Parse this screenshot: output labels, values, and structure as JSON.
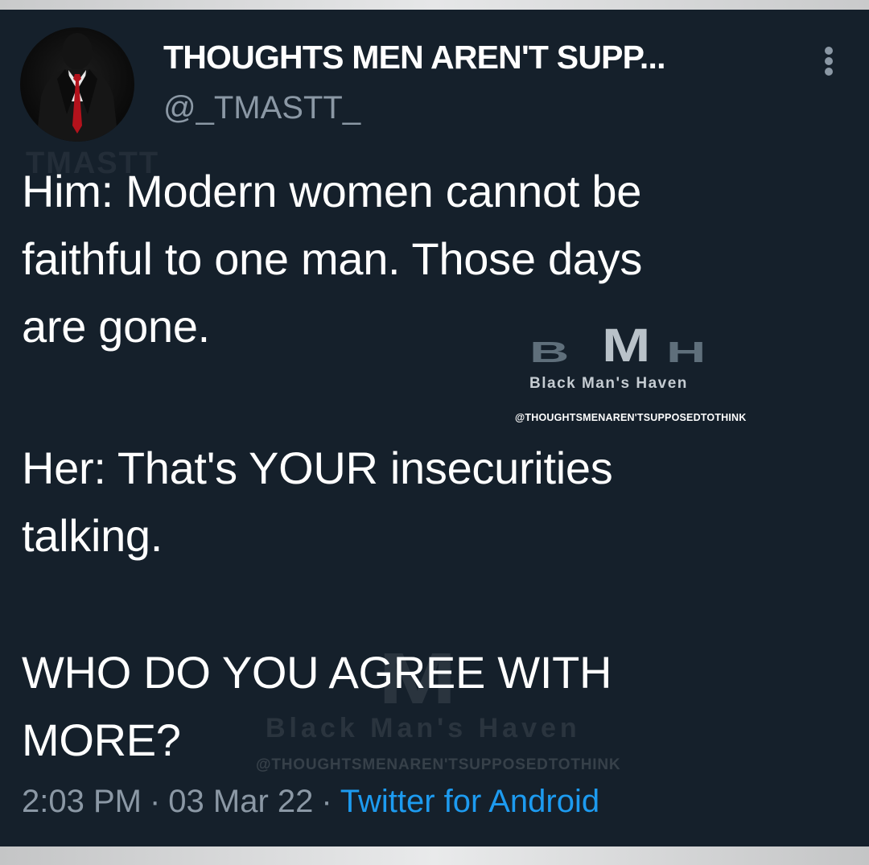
{
  "tweet": {
    "author": {
      "display_name": "THOUGHTS MEN AREN'T SUPP...",
      "handle": "@_TMASTT_"
    },
    "text_paragraphs": [
      [
        "Him: Modern women cannot be",
        "faithful to one man. Those days",
        "are gone."
      ],
      [
        "Her: That's YOUR insecurities",
        "talking."
      ],
      [
        "WHO DO YOU AGREE WITH",
        "MORE?"
      ]
    ],
    "meta": {
      "time": "2:03 PM",
      "date": "03 Mar 22",
      "separator": "·",
      "source": "Twitter for Android"
    }
  },
  "watermark": {
    "logo_letters": [
      "B",
      "M",
      "H"
    ],
    "tagline": "Black Man's Haven",
    "handle": "@THOUGHTSMENAREN'TSUPPOSEDTOTHINK"
  },
  "icons": {
    "more": "more-vertical-icon",
    "avatar": "suited-man-avatar"
  },
  "colors": {
    "background": "#15202b",
    "text": "#ffffff",
    "secondary_text": "#8b98a5",
    "link": "#1d9bf0"
  }
}
